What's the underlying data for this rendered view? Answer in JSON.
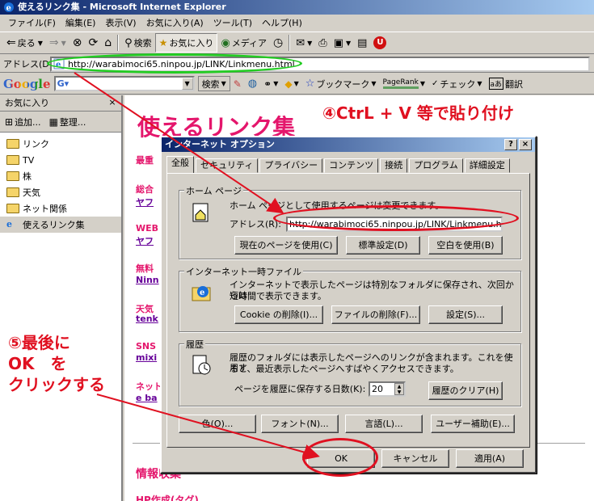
{
  "window": {
    "title": "使えるリンク集 - Microsoft Internet Explorer"
  },
  "menu": [
    "ファイル(F)",
    "編集(E)",
    "表示(V)",
    "お気に入り(A)",
    "ツール(T)",
    "ヘルプ(H)"
  ],
  "toolbar": {
    "back": "戻る",
    "search": "検索",
    "favorites": "お気に入り",
    "media": "メディア"
  },
  "address": {
    "label": "アドレス(D)",
    "url": "http://warabimoci65.ninpou.jp/LINK/Linkmenu.html"
  },
  "google": {
    "logo": "Google",
    "search_btn": "検索",
    "bookmark": "ブックマーク",
    "pagerank": "PageRank",
    "check": "チェック",
    "translate": "翻訳"
  },
  "favorites": {
    "header": "お気に入り",
    "close": "×",
    "add": "追加...",
    "organize": "整理...",
    "items": [
      "リンク",
      "TV",
      "株",
      "天気",
      "ネット関係",
      "使えるリンク集"
    ]
  },
  "content": {
    "title": "使えるリンク集",
    "instruction": "④CtrL + V 等で貼り付け",
    "lines": [
      {
        "t": "最重",
        "cls": "cat"
      },
      {
        "t": "総合",
        "cls": "cat"
      },
      {
        "t": "ヤフ",
        "cls": "lnk"
      },
      {
        "t": "WEB",
        "cls": "cat"
      },
      {
        "t": "ヤフ",
        "cls": "lnk"
      },
      {
        "t": "無料",
        "cls": "cat"
      },
      {
        "t": "Ninn",
        "cls": "lnk"
      },
      {
        "t": "天気",
        "cls": "cat"
      },
      {
        "t": "tenk",
        "cls": "lnk"
      },
      {
        "t": "SNS",
        "cls": "cat"
      },
      {
        "t": "mixi",
        "cls": "lnk"
      },
      {
        "t": "ネット",
        "cls": "cat"
      },
      {
        "t": "e ba",
        "cls": "lnk"
      }
    ],
    "bottom1": "情報収集",
    "bottom2": "HP作成(タグ)"
  },
  "dialog": {
    "title": "インターネット オプション",
    "help": "?",
    "close": "×",
    "tabs": [
      "全般",
      "セキュリティ",
      "プライバシー",
      "コンテンツ",
      "接続",
      "プログラム",
      "詳細設定"
    ],
    "home": {
      "label": "ホーム ページ",
      "desc": "ホーム ページとして使用するページは変更できます。",
      "addr_label": "アドレス(R):",
      "addr_value": "http://warabimoci65.ninpou.jp/LINK/Linkmenu.html",
      "btn_current": "現在のページを使用(C)",
      "btn_default": "標準設定(D)",
      "btn_blank": "空白を使用(B)"
    },
    "temp": {
      "label": "インターネット一時ファイル",
      "desc1": "インターネットで表示したページは特別なフォルダに保存され、次回からは",
      "desc2": "短時間で表示できます。",
      "btn_cookie": "Cookie の削除(I)...",
      "btn_files": "ファイルの削除(F)...",
      "btn_settings": "設定(S)..."
    },
    "history": {
      "label": "履歴",
      "desc1": "履歴のフォルダには表示したページへのリンクが含まれます。これを使用す",
      "desc2": "ると、最近表示したページへすばやくアクセスできます。",
      "days_label": "ページを履歴に保存する日数(K):",
      "days_value": "20",
      "btn_clear": "履歴のクリア(H)"
    },
    "bottom_buttons": [
      "色(O)...",
      "フォント(N)...",
      "言語(L)...",
      "ユーザー補助(E)..."
    ],
    "ok": "OK",
    "cancel": "キャンセル",
    "apply": "適用(A)"
  },
  "annotations": {
    "step5_line1": "⑤最後に",
    "step5_line2": "OK　を",
    "step5_line3": "クリックする",
    "oval_colors": {
      "address": "#22cc22",
      "dialog": "#e01020"
    }
  }
}
